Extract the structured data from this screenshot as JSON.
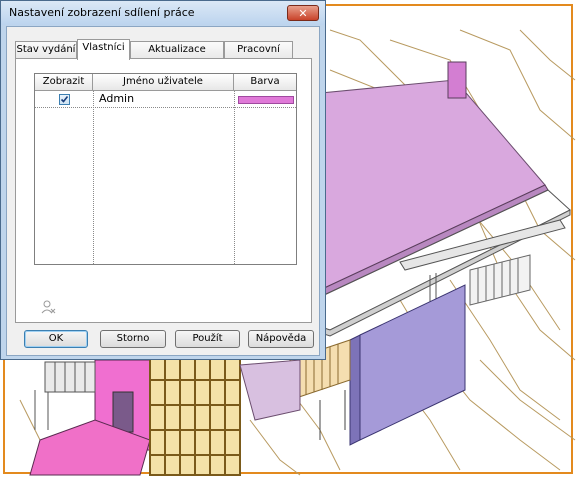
{
  "dialog": {
    "title": "Nastavení zobrazení sdílení práce",
    "close_label": "✕",
    "tabs": [
      {
        "label": "Stav vydání",
        "active": false
      },
      {
        "label": "Vlastníci",
        "active": true
      },
      {
        "label": "Aktualizace modelu",
        "active": false
      },
      {
        "label": "Pracovní sady",
        "active": false
      }
    ],
    "table": {
      "columns": [
        "Zobrazit",
        "Jméno uživatele",
        "Barva"
      ],
      "rows": [
        {
          "show": true,
          "user": "Admin",
          "color": "#e07ad8"
        }
      ]
    },
    "icons": {
      "user_remove": "user-remove-icon"
    },
    "buttons": {
      "ok": "OK",
      "cancel": "Storno",
      "apply": "Použít",
      "help": "Nápověda"
    }
  },
  "colors": {
    "viewport_frame": "#e38a1e",
    "owner_highlight": "#e07ad8",
    "dialog_titlebar": "#bfd5ec"
  }
}
